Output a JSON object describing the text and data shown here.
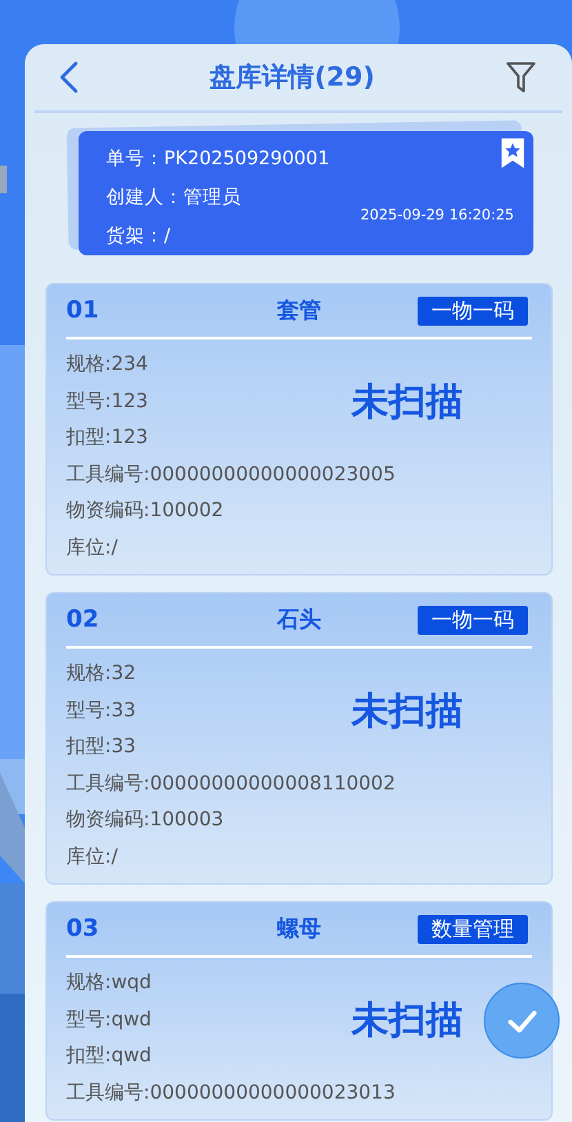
{
  "header": {
    "title": "盘库详情(29)"
  },
  "summary": {
    "lines": [
      "单号：PK202509290001",
      "创建人：管理员",
      "货架：/"
    ],
    "time": "2025-09-29 16:20:25"
  },
  "items": [
    {
      "number": "01",
      "name": "套管",
      "tag": "一物一码",
      "status": "未扫描",
      "fields": [
        "规格:234",
        "型号:123",
        "扣型:123",
        "工具编号:00000000000000023005",
        "物资编码:100002",
        "库位:/"
      ]
    },
    {
      "number": "02",
      "name": "石头",
      "tag": "一物一码",
      "status": "未扫描",
      "fields": [
        "规格:32",
        "型号:33",
        "扣型:33",
        "工具编号:00000000000008110002",
        "物资编码:100003",
        "库位:/"
      ]
    },
    {
      "number": "03",
      "name": "螺母",
      "tag": "数量管理",
      "status": "未扫描",
      "fields": [
        "规格:wqd",
        "型号:qwd",
        "扣型:qwd",
        "工具编号:00000000000000023013"
      ]
    }
  ]
}
